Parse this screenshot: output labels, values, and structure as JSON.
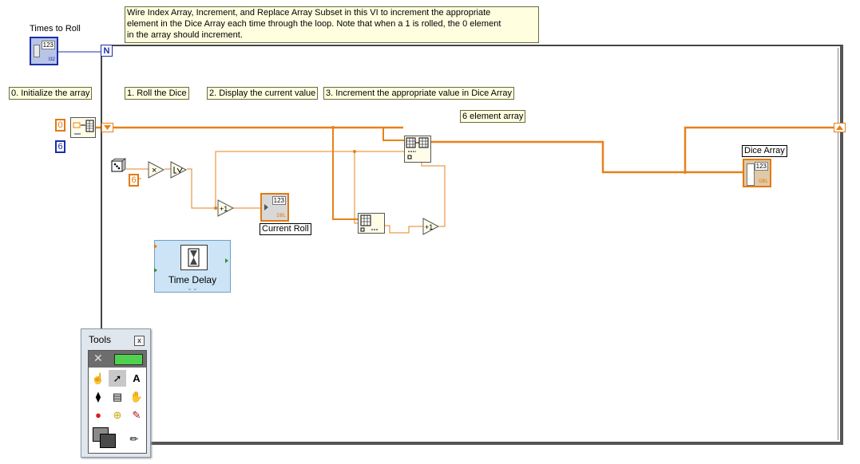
{
  "comment": {
    "line1": "Wire Index Array, Increment, and Replace Array Subset in this VI to increment the appropriate",
    "line2": "element in the Dice Array each time through the loop.  Note that when a 1 is rolled, the 0 element",
    "line3": "in the array should increment."
  },
  "times_to_roll": {
    "label": "Times to Roll",
    "display": "123",
    "type": "I32"
  },
  "loop": {
    "count_terminal": "N"
  },
  "steps": {
    "step0": "0. Initialize the array",
    "step1": "1. Roll the Dice",
    "step2": "2. Display the current value",
    "step3": "3. Increment the appropriate value in Dice Array",
    "note": "6 element array"
  },
  "constants": {
    "init_value": "0",
    "init_size": "6",
    "multiplier": "6"
  },
  "current_roll": {
    "label": "Current Roll",
    "display": "123",
    "type": "DBL"
  },
  "dice_array": {
    "label": "Dice Array",
    "display": "123",
    "type": "DBL"
  },
  "time_delay": {
    "label": "Time Delay"
  },
  "tools": {
    "title": "Tools",
    "close": "x"
  },
  "colors": {
    "integer_wire": "#1a2ea8",
    "double_wire": "#e27a12",
    "comment_bg": "#ffffe0",
    "express_vi_bg": "#cce4f6"
  }
}
